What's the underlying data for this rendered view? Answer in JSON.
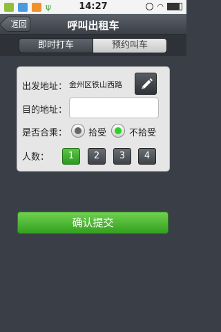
{
  "status_bar": {
    "time": "14:27"
  },
  "header": {
    "back_label": "返回",
    "title": "呼叫出租车"
  },
  "tabs": [
    {
      "label": "即时打车",
      "active": true
    },
    {
      "label": "预约叫车",
      "active": false
    }
  ],
  "form": {
    "departure_label": "出发地址：",
    "departure_value": "金州区铁山西路",
    "destination_label": "目的地址：",
    "destination_value": "",
    "carpool_label": "是否合乘：",
    "carpool_options": [
      {
        "label": "拾受",
        "selected": false
      },
      {
        "label": "不拾受",
        "selected": true
      }
    ],
    "people_label": "人数：",
    "people_options": [
      "1",
      "2",
      "3",
      "4"
    ],
    "people_selected": "1"
  },
  "submit_label": "确认提交",
  "colors": {
    "accent_green": "#33a11f",
    "dark_bar": "#3a3f47"
  }
}
